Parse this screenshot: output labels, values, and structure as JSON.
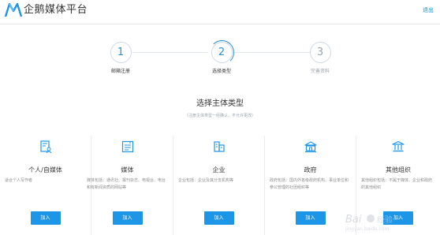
{
  "header": {
    "brand": "企鹅媒体平台",
    "logout_label": "退出"
  },
  "steps": [
    {
      "number": "1",
      "label": "邮箱注册",
      "state": "done"
    },
    {
      "number": "2",
      "label": "选择类型",
      "state": "active"
    },
    {
      "number": "3",
      "label": "完善资料",
      "state": "pending"
    }
  ],
  "page": {
    "title": "选择主体类型",
    "subtitle": "（注册主体类型一经确认，不允许更改）"
  },
  "cards": [
    {
      "icon": "id-card-icon",
      "name": "个人/自媒体",
      "desc": "适合个人写作者",
      "button": "加入"
    },
    {
      "icon": "newspaper-icon",
      "name": "媒体",
      "desc": "媒体包括：通讯社、报刊杂志、电视台、电台和有新闻资质的网站等",
      "button": "加入"
    },
    {
      "icon": "building-icon",
      "name": "企业",
      "desc": "企业包括：企业及其分支机构等",
      "button": "加入"
    },
    {
      "icon": "government-icon",
      "name": "政府",
      "desc": "政府包括：国内外各级政府机构、事业单位和参公管理的社团组织等",
      "button": "加入"
    },
    {
      "icon": "institution-icon",
      "name": "其他组织",
      "desc": "其他组织包括：不属于媒体、企业和政府的其他组织",
      "button": "加入"
    }
  ],
  "colors": {
    "accent": "#1e96e8",
    "link": "#1a8fd6"
  }
}
